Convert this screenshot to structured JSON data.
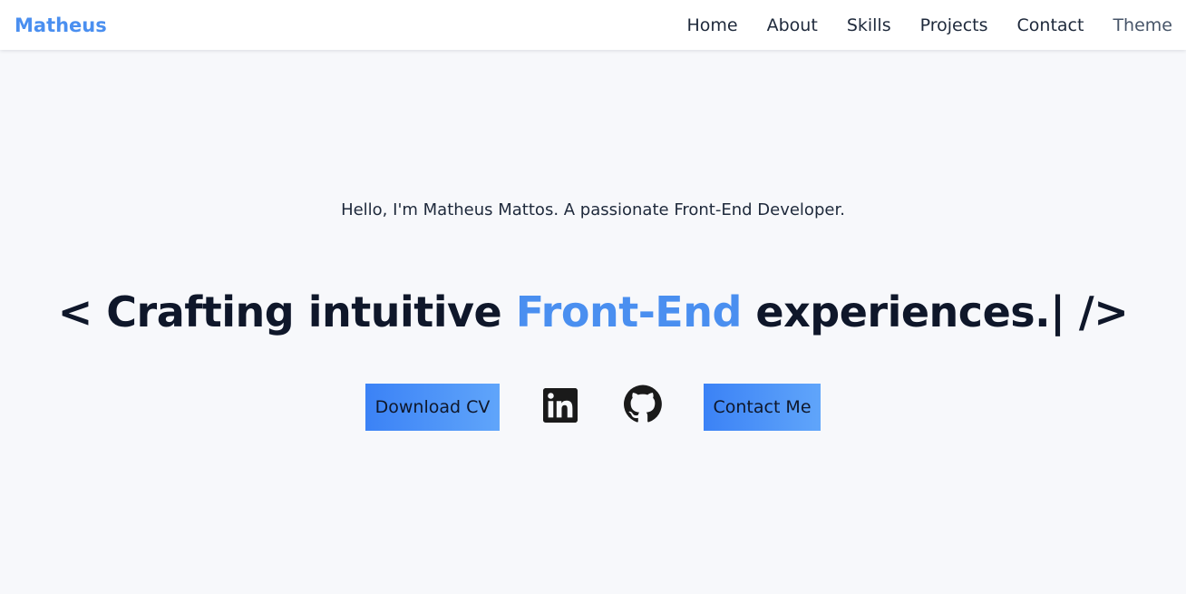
{
  "nav": {
    "brand": "Matheus",
    "links": [
      "Home",
      "About",
      "Skills",
      "Projects",
      "Contact"
    ],
    "theme_label": "Theme"
  },
  "hero": {
    "intro": "Hello, I'm Matheus Mattos. A passionate Front-End Developer.",
    "headline_prefix": "< Crafting intuitive ",
    "headline_accent": "Front-End",
    "headline_suffix": " experiences.| />",
    "download_cv_label": "Download CV",
    "contact_label": "Contact Me",
    "social_icons": [
      "linkedin-icon",
      "github-icon"
    ]
  },
  "colors": {
    "accent": "#4a8ff0",
    "background": "#f7f8fb",
    "text": "#0f172a",
    "button_gradient_start": "#3b82f6",
    "button_gradient_end": "#60a5fa"
  }
}
